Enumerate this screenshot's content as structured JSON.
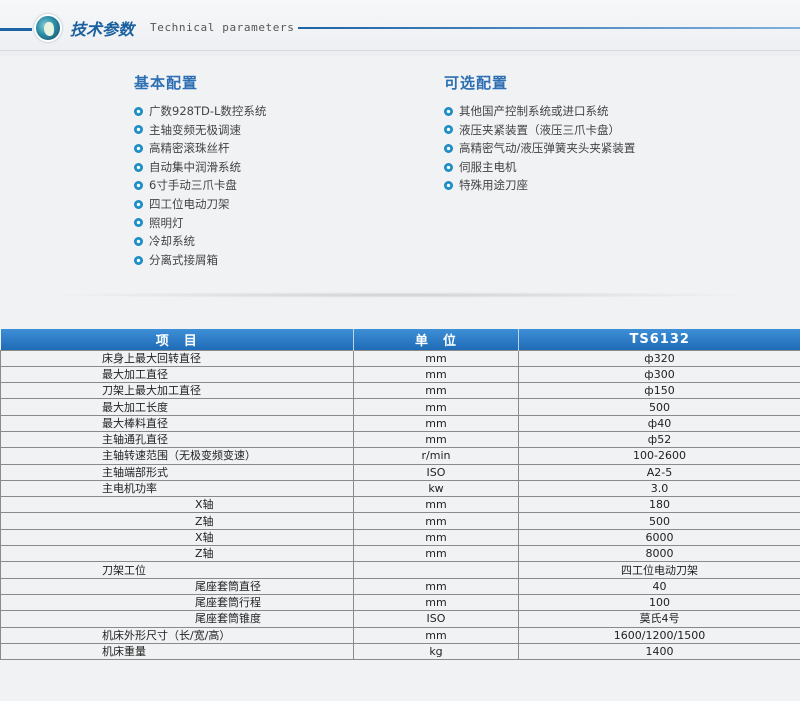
{
  "header": {
    "title_cn": "技术参数",
    "title_en": "Technical parameters"
  },
  "basic_config": {
    "heading": "基本配置",
    "items": [
      "广数928TD-L数控系统",
      "主轴变频无极调速",
      "高精密滚珠丝杆",
      "自动集中润滑系统",
      "6寸手动三爪卡盘",
      "四工位电动刀架",
      "照明灯",
      "冷却系统",
      "分离式接屑箱"
    ]
  },
  "optional_config": {
    "heading": "可选配置",
    "items": [
      "其他国产控制系统或进口系统",
      "液压夹紧装置（液压三爪卡盘）",
      "高精密气动/液压弹簧夹头夹紧装置",
      "伺服主电机",
      "特殊用途刀座"
    ]
  },
  "table": {
    "headers": [
      "项　目",
      "单　位",
      "TS6132"
    ],
    "rows": [
      {
        "item": "床身上最大回转直径",
        "unit": "mm",
        "value": "ф320",
        "sub": false
      },
      {
        "item": "最大加工直径",
        "unit": "mm",
        "value": "ф300",
        "sub": false
      },
      {
        "item": "刀架上最大加工直径",
        "unit": "mm",
        "value": "ф150",
        "sub": false
      },
      {
        "item": "最大加工长度",
        "unit": "mm",
        "value": "500",
        "sub": false
      },
      {
        "item": "最大棒料直径",
        "unit": "mm",
        "value": "ф40",
        "sub": false
      },
      {
        "item": "主轴通孔直径",
        "unit": "mm",
        "value": "ф52",
        "sub": false
      },
      {
        "item": "主轴转速范围（无极变频变速）",
        "unit": "r/min",
        "value": "100-2600",
        "sub": false
      },
      {
        "item": "主轴端部形式",
        "unit": "ISO",
        "value": "A2-5",
        "sub": false
      },
      {
        "item": "主电机功率",
        "unit": "kw",
        "value": "3.0",
        "sub": false
      },
      {
        "item": "X轴",
        "unit": "mm",
        "value": "180",
        "sub": true
      },
      {
        "item": "Z轴",
        "unit": "mm",
        "value": "500",
        "sub": true
      },
      {
        "item": "X轴",
        "unit": "mm",
        "value": "6000",
        "sub": true
      },
      {
        "item": "Z轴",
        "unit": "mm",
        "value": "8000",
        "sub": true
      },
      {
        "item": "刀架工位",
        "unit": "",
        "value": "四工位电动刀架",
        "sub": false
      },
      {
        "item": "尾座套筒直径",
        "unit": "mm",
        "value": "40",
        "sub": true
      },
      {
        "item": "尾座套筒行程",
        "unit": "mm",
        "value": "100",
        "sub": true
      },
      {
        "item": "尾座套筒锥度",
        "unit": "ISO",
        "value": "莫氏4号",
        "sub": true
      },
      {
        "item": "机床外形尺寸（长/宽/高）",
        "unit": "mm",
        "value": "1600/1200/1500",
        "sub": false
      },
      {
        "item": "机床重量",
        "unit": "kg",
        "value": "1400",
        "sub": false
      }
    ]
  }
}
